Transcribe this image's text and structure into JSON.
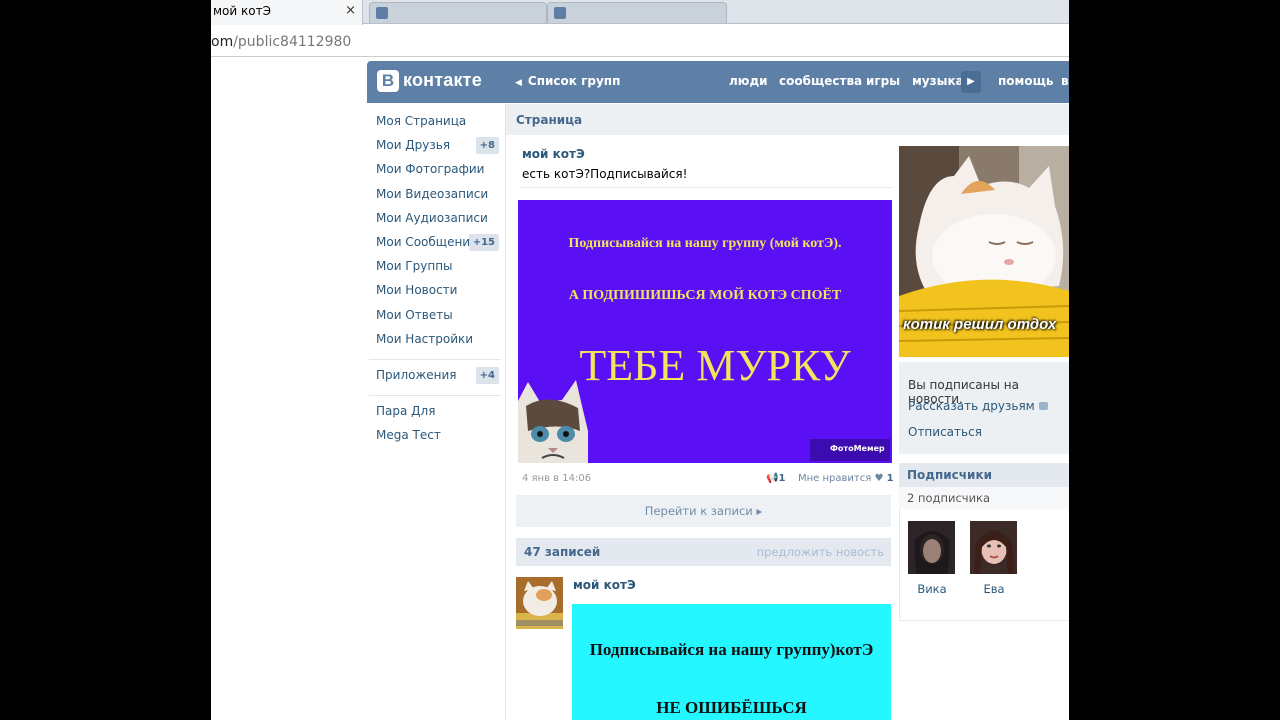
{
  "browser": {
    "active_tab_title": "мой котЭ",
    "tab_close": "×",
    "url_prefix": "om",
    "url_path": "/public84112980"
  },
  "header": {
    "logo_letter": "B",
    "logo_text": "контакте",
    "back_label": "Список групп",
    "nav": {
      "people": "люди",
      "communities": "сообщества",
      "games": "игры",
      "music": "музыка",
      "help": "помощь",
      "cut": "в"
    }
  },
  "leftmenu": {
    "items": [
      {
        "label": "Моя Страница",
        "count": ""
      },
      {
        "label": "Мои Друзья",
        "count": "+8"
      },
      {
        "label": "Мои Фотографии",
        "count": ""
      },
      {
        "label": "Мои Видеозаписи",
        "count": ""
      },
      {
        "label": "Мои Аудиозаписи",
        "count": ""
      },
      {
        "label": "Мои Сообщения",
        "count": "+15"
      },
      {
        "label": "Мои Группы",
        "count": ""
      },
      {
        "label": "Мои Новости",
        "count": ""
      },
      {
        "label": "Мои Ответы",
        "count": ""
      },
      {
        "label": "Мои Настройки",
        "count": ""
      }
    ],
    "apps": {
      "label": "Приложения",
      "count": "+4"
    },
    "extra": [
      "Пара Для",
      "Mega Тест"
    ]
  },
  "main": {
    "bar_title": "Страница",
    "post": {
      "author": "мой котЭ",
      "text": "есть котЭ?Подписывайся!",
      "image_line1": "Подписывайся на нашу группу (мой котЭ).",
      "image_line2": "А ПОДПИШИШЬСЯ МОЙ КОТЭ СПОЁТ",
      "image_line3": "ТЕБЕ МУРКУ",
      "watermark": "ФотоМемер",
      "date": "4 янв в 14:06",
      "shares": "1",
      "likes_label": "Мне нравится",
      "likes": "1",
      "goto_label": "Перейти к записи"
    },
    "wall": {
      "count_label": "47 записей",
      "suggest_label": "предложить новость"
    },
    "post2": {
      "author": "мой котЭ",
      "image_line1": "Подписывайся на нашу группу)котЭ",
      "image_line2": "НЕ ОШИБЁШЬСЯ"
    }
  },
  "right": {
    "cover_caption": "котик решил отдох",
    "subscribed_status": "Вы подписаны на новости.",
    "tell_friends": "Рассказать друзьям",
    "unsubscribe": "Отписаться",
    "followers_title": "Подписчики",
    "followers_count": "2 подписчика",
    "followers": [
      {
        "name": "Вика"
      },
      {
        "name": "Ева"
      }
    ]
  }
}
